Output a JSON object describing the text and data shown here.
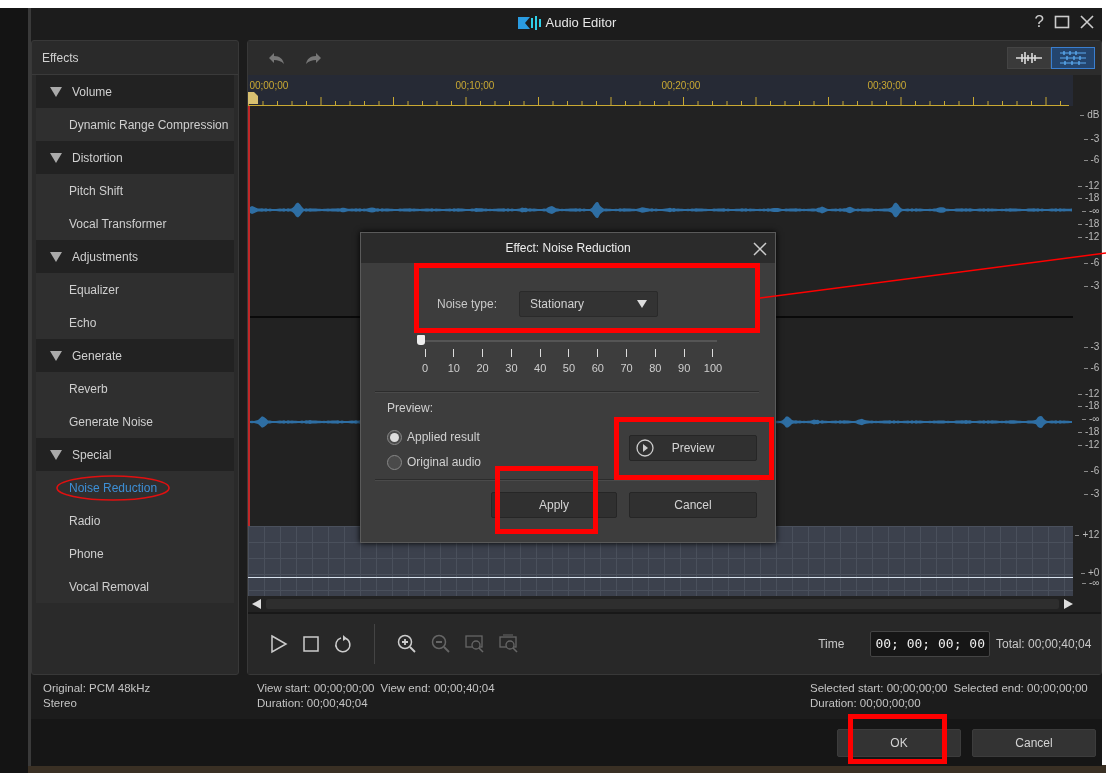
{
  "window": {
    "title": "Audio Editor",
    "help": "?"
  },
  "effects_panel": {
    "title": "Effects",
    "groups": [
      {
        "label": "Volume",
        "expanded": true,
        "items": [
          {
            "label": "Dynamic Range Compression",
            "selected": false,
            "circled": false
          }
        ]
      },
      {
        "label": "Distortion",
        "expanded": true,
        "items": [
          {
            "label": "Pitch Shift",
            "selected": false,
            "circled": false
          },
          {
            "label": "Vocal Transformer",
            "selected": false,
            "circled": false
          }
        ]
      },
      {
        "label": "Adjustments",
        "expanded": true,
        "items": [
          {
            "label": "Equalizer",
            "selected": false,
            "circled": false
          },
          {
            "label": "Echo",
            "selected": false,
            "circled": false
          }
        ]
      },
      {
        "label": "Generate",
        "expanded": true,
        "items": [
          {
            "label": "Reverb",
            "selected": false,
            "circled": false
          },
          {
            "label": "Generate Noise",
            "selected": false,
            "circled": false
          }
        ]
      },
      {
        "label": "Special",
        "expanded": true,
        "items": [
          {
            "label": "Noise Reduction",
            "selected": true,
            "circled": true
          },
          {
            "label": "Radio",
            "selected": false,
            "circled": false
          },
          {
            "label": "Phone",
            "selected": false,
            "circled": false
          },
          {
            "label": "Vocal Removal",
            "selected": false,
            "circled": false
          }
        ]
      }
    ]
  },
  "toolbar": {
    "view_modes": [
      {
        "selected": false
      },
      {
        "selected": true
      }
    ]
  },
  "ruler": {
    "labels": [
      "00;00;00",
      "00;10;00",
      "00;20;00",
      "00;30;00"
    ]
  },
  "db_scale": {
    "unit": "dB",
    "channels": [
      [
        "-3",
        "-6",
        "-12",
        "-18",
        "-∞",
        "-18",
        "-12",
        "-6",
        "-3"
      ],
      [
        "-3",
        "-6",
        "-12",
        "-18",
        "-∞",
        "-18",
        "-12",
        "-6",
        "-3"
      ]
    ],
    "envelope": [
      "+12",
      "+0",
      "-∞"
    ]
  },
  "dialog": {
    "title": "Effect: Noise Reduction",
    "noise_type_label": "Noise type:",
    "noise_type_value": "Stationary",
    "noise_type_highlighted": true,
    "strength": {
      "level": 0,
      "ticks": [
        "0",
        "10",
        "20",
        "30",
        "40",
        "50",
        "60",
        "70",
        "80",
        "90",
        "100"
      ]
    },
    "preview_label": "Preview:",
    "preview_options": [
      {
        "label": "Applied result",
        "selected": true
      },
      {
        "label": "Original audio",
        "selected": false
      }
    ],
    "preview_button": {
      "label": "Preview",
      "highlighted": true
    },
    "apply_button": {
      "label": "Apply",
      "highlighted": true
    },
    "cancel_button": {
      "label": "Cancel"
    }
  },
  "transport": {
    "zoom_tools": [
      {
        "disabled": false
      },
      {
        "disabled": true
      },
      {
        "disabled": true
      },
      {
        "disabled": true
      }
    ],
    "time_label": "Time",
    "time_value": "00; 00; 00; 00",
    "total": "Total: 00;00;40;04"
  },
  "status": {
    "format": "Original: PCM 48kHz",
    "channels": "Stereo",
    "view_start": "View start: 00;00;00;00",
    "view_end": "View end: 00;00;40;04",
    "view_duration": "Duration: 00;00;40;04",
    "selected_start": "Selected start: 00;00;00;00",
    "selected_end": "Selected end: 00;00;00;00",
    "selected_duration": "Duration: 00;00;00;00"
  },
  "footer": {
    "ok_button": {
      "label": "OK",
      "highlighted": true
    },
    "cancel_button": {
      "label": "Cancel"
    }
  }
}
